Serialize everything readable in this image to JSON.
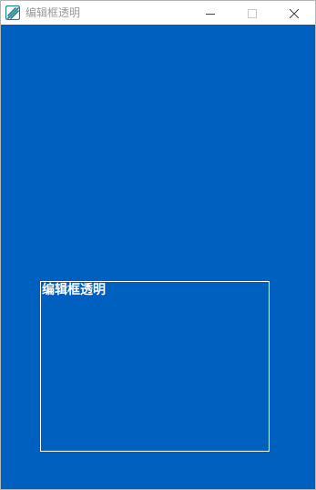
{
  "window": {
    "title": "编辑框透明",
    "controls": {
      "minimize_icon": "minimize-icon",
      "maximize_icon": "maximize-icon",
      "close_icon": "close-icon"
    }
  },
  "client": {
    "background_color": "#0060c0",
    "edit_box": {
      "text": "编辑框透明",
      "border_color": "#ffffff",
      "text_color": "#ffffff"
    }
  },
  "colors": {
    "title_text": "#9a9a9a",
    "app_icon": "#1a7f8e"
  }
}
